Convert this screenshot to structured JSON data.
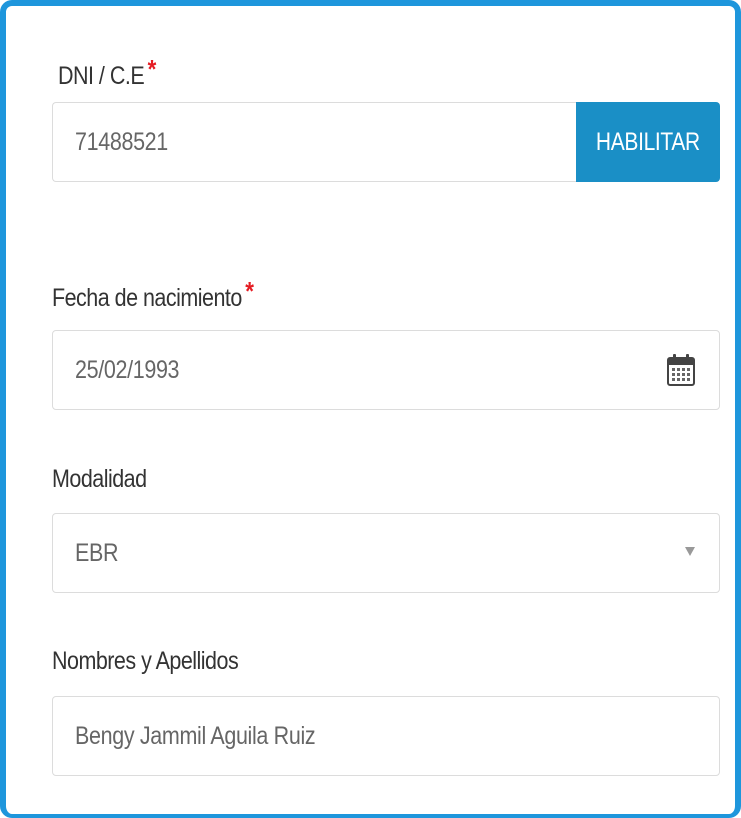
{
  "form": {
    "dni": {
      "label": "DNI / C.E",
      "required_mark": "*",
      "value": "71488521",
      "button_label": "HABILITAR"
    },
    "birthdate": {
      "label": "Fecha de nacimiento",
      "required_mark": "*",
      "value": "25/02/1993",
      "icon": "calendar-icon"
    },
    "modality": {
      "label": "Modalidad",
      "selected": "EBR",
      "icon": "dropdown-caret-icon"
    },
    "full_name": {
      "label": "Nombres y Apellidos",
      "value": "Bengy Jammil Aguila Ruiz"
    }
  },
  "colors": {
    "frame_border": "#1e96dc",
    "button_bg": "#1a8fc6",
    "required": "#e51c23"
  }
}
